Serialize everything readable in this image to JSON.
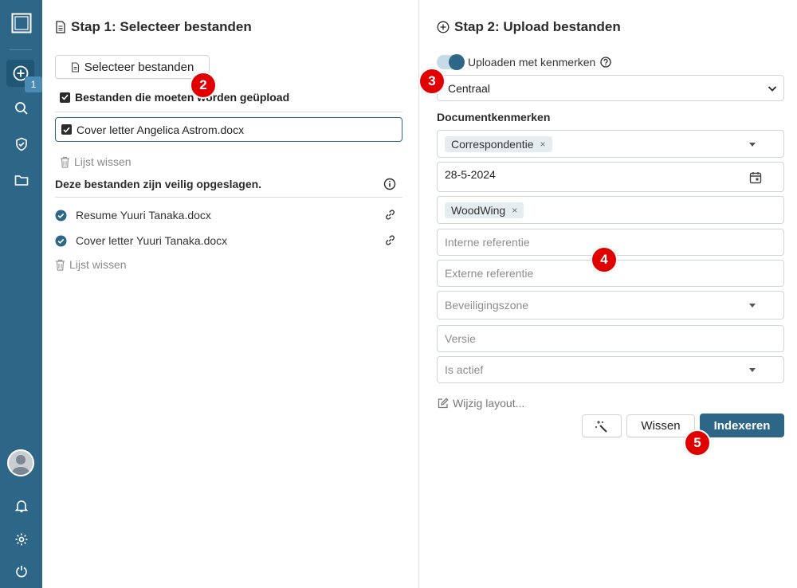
{
  "sidebar": {
    "upload_badge": "1"
  },
  "left": {
    "title": "Stap 1: Selecteer bestanden",
    "select_button": "Selecteer bestanden",
    "upload_header": "Bestanden die moeten worden geüpload",
    "pending_files": [
      "Cover letter Angelica Astrom.docx"
    ],
    "clear_pending": "Lijst wissen",
    "safe_header": "Deze bestanden zijn veilig opgeslagen.",
    "saved_files": [
      "Resume Yuuri Tanaka.docx",
      "Cover letter Yuuri Tanaka.docx"
    ],
    "clear_saved": "Lijst wissen"
  },
  "right": {
    "title": "Stap 2: Upload bestanden",
    "toggle_label": "Uploaden met kenmerken",
    "location_select": "Centraal",
    "section_label": "Documentkenmerken",
    "fields": {
      "category_chip": "Correspondentie",
      "date": "28-5-2024",
      "tag_chip": "WoodWing",
      "internal_ref_placeholder": "Interne referentie",
      "external_ref_placeholder": "Externe referentie",
      "security_zone_placeholder": "Beveiligingszone",
      "version_placeholder": "Versie",
      "active_placeholder": "Is actief"
    },
    "layout_link": "Wijzig layout...",
    "clear_button": "Wissen",
    "index_button": "Indexeren"
  },
  "steps": [
    "2",
    "3",
    "4",
    "5"
  ],
  "colors": {
    "sidebar": "#2e6687",
    "accent": "#2e6687",
    "step_marker": "#e00000"
  }
}
